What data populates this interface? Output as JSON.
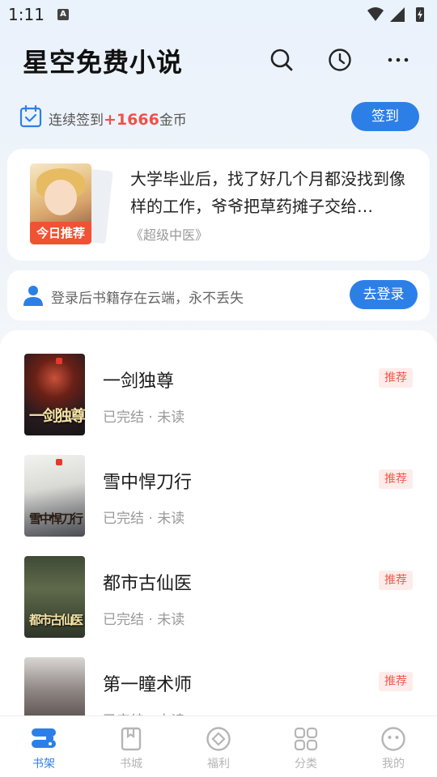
{
  "status_bar": {
    "time": "1:11",
    "notif_icon": "A"
  },
  "header": {
    "title": "星空免费小说",
    "search_icon": "search-icon",
    "history_icon": "clock-icon",
    "more_icon": "more-icon"
  },
  "checkin": {
    "prefix": "连续签到",
    "bonus": "+1666",
    "suffix": "金币",
    "button": "签到"
  },
  "recommend": {
    "badge": "今日推荐",
    "description": "大学毕业后，找了好几个月都没找到像样的工作，爷爷把草药摊子交给…",
    "book_title": "《超级中医》"
  },
  "login": {
    "text": "登录后书籍存在云端，永不丢失",
    "button": "去登录"
  },
  "books": [
    {
      "title": "一剑独尊",
      "status": "已完结 · 未读",
      "tag": "推荐",
      "cover_text": "一剑独尊"
    },
    {
      "title": "雪中悍刀行",
      "status": "已完结 · 未读",
      "tag": "推荐",
      "cover_text": "雪中悍刀行"
    },
    {
      "title": "都市古仙医",
      "status": "已完结 · 未读",
      "tag": "推荐",
      "cover_text": "都市古仙医"
    },
    {
      "title": "第一瞳术师",
      "status": "已完结 · 未读",
      "tag": "推荐",
      "cover_text": ""
    }
  ],
  "tabs": [
    {
      "label": "书架",
      "icon": "bookshelf-icon",
      "active": true
    },
    {
      "label": "书城",
      "icon": "book-icon",
      "active": false
    },
    {
      "label": "福利",
      "icon": "coin-icon",
      "active": false
    },
    {
      "label": "分类",
      "icon": "grid-icon",
      "active": false
    },
    {
      "label": "我的",
      "icon": "smile-face-icon",
      "active": false
    }
  ],
  "colors": {
    "accent": "#2d7fe8",
    "bonus": "#f0504a",
    "tag_bg": "#fdecea",
    "tag_text": "#f05a4a"
  }
}
